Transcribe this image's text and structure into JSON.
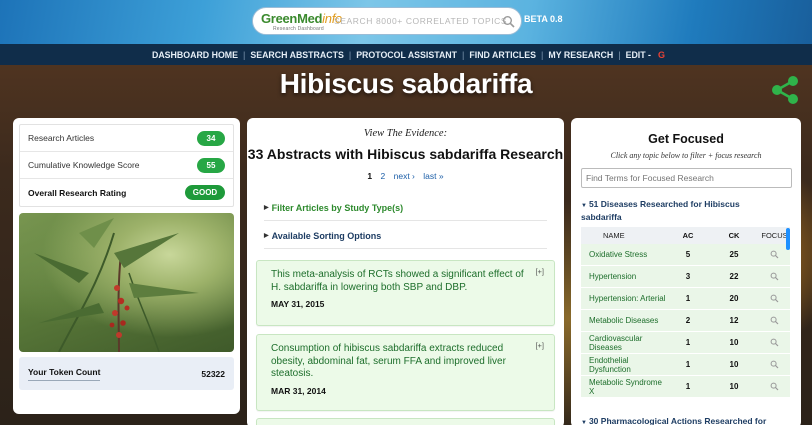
{
  "header": {
    "logo_text": "GreenMed",
    "logo_accent": "info",
    "logo_sub": "Research Dashboard",
    "search_placeholder": "SEARCH 8000+ CORRELATED TOPICS",
    "beta": "BETA 0.8"
  },
  "nav": {
    "items": [
      "DASHBOARD HOME",
      "SEARCH ABSTRACTS",
      "PROTOCOL ASSISTANT",
      "FIND ARTICLES",
      "MY RESEARCH",
      "EDIT -"
    ],
    "separator": "|",
    "google_glyph": "G"
  },
  "page": {
    "title": "Hibiscus sabdariffa"
  },
  "left": {
    "stats": [
      {
        "label": "Research Articles",
        "value": "34"
      },
      {
        "label": "Cumulative Knowledge Score",
        "value": "55"
      },
      {
        "label": "Overall Research Rating",
        "value": "GOOD"
      }
    ],
    "token_label": "Your Token Count",
    "token_value": "52322"
  },
  "center": {
    "view_evidence": "View The Evidence:",
    "heading": "33 Abstracts with Hibiscus sabdariffa Research",
    "pager": {
      "current": "1",
      "page2": "2",
      "next": "next ›",
      "last": "last »"
    },
    "filter_label": "Filter Articles by Study Type(s)",
    "sort_label": "Available Sorting Options",
    "expand": "[+]",
    "abstracts": [
      {
        "text": "This meta-analysis of RCTs showed a significant effect of H. sabdariffa in lowering both SBP and DBP.",
        "date": "MAY 31, 2015"
      },
      {
        "text": "Consumption of hibiscus sabdariffa extracts reduced obesity, abdominal fat, serum FFA and improved liver steatosis.",
        "date": "MAR 31, 2014"
      }
    ]
  },
  "right": {
    "title": "Get Focused",
    "subtitle": "Click any topic below to filter + focus research",
    "filter_placeholder": "Find Terms for Focused Research",
    "diseases_heading": "51 Diseases Researched for Hibiscus sabdariffa",
    "columns": {
      "name": "NAME",
      "ac": "AC",
      "ck": "CK",
      "focus": "FOCUS"
    },
    "rows": [
      {
        "name": "Oxidative Stress",
        "ac": "5",
        "ck": "25"
      },
      {
        "name": "Hypertension",
        "ac": "3",
        "ck": "22"
      },
      {
        "name": "Hypertension: Arterial",
        "ac": "1",
        "ck": "20"
      },
      {
        "name": "Metabolic Diseases",
        "ac": "2",
        "ck": "12"
      },
      {
        "name": "Cardiovascular Diseases",
        "ac": "1",
        "ck": "10"
      },
      {
        "name": "Endothelial Dysfunction",
        "ac": "1",
        "ck": "10"
      },
      {
        "name": "Metabolic Syndrome X",
        "ac": "1",
        "ck": "10"
      }
    ],
    "pharm_heading": "30 Pharmacological Actions Researched for"
  },
  "colors": {
    "nav_bg": "#102d4a",
    "pill_green": "#27a745",
    "abstract_bg": "#ecfae8",
    "link_blue": "#1d5fa8"
  }
}
